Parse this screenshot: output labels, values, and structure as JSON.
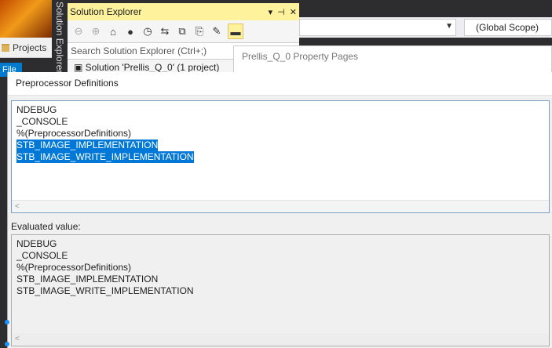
{
  "main_window": {
    "tab_projects": "Projects",
    "menu_file": "File",
    "vertical_tab": "Solution Explorer"
  },
  "solution_explorer": {
    "title": "Solution Explorer",
    "title_controls": [
      "▾",
      "⊣",
      "✕"
    ],
    "toolbar_icons": [
      "back-icon",
      "forward-icon",
      "home-icon",
      "globe-icon",
      "history-icon",
      "sync-icon",
      "collapse-all-icon",
      "show-all-files-icon",
      "properties-icon",
      "preview-icon"
    ],
    "search_placeholder": "Search Solution Explorer (Ctrl+;)",
    "tree_root": "Solution 'Prellis_Q_0' (1 project)"
  },
  "editor_nav": {
    "scope_combo_value": "",
    "global_scope": "(Global Scope)"
  },
  "property_pages": {
    "title": "Prellis_Q_0 Property Pages"
  },
  "dialog": {
    "title": "Preprocessor Definitions",
    "edit_lines": [
      {
        "text": "NDEBUG",
        "selected": false
      },
      {
        "text": "_CONSOLE",
        "selected": false
      },
      {
        "text": "%(PreprocessorDefinitions)",
        "selected": false
      },
      {
        "text": "STB_IMAGE_IMPLEMENTATION",
        "selected": true
      },
      {
        "text": "STB_IMAGE_WRITE_IMPLEMENTATION",
        "selected": true
      }
    ],
    "evaluated_label": "Evaluated value:",
    "evaluated_lines": [
      "NDEBUG",
      "_CONSOLE",
      "%(PreprocessorDefinitions)",
      "STB_IMAGE_IMPLEMENTATION",
      "STB_IMAGE_WRITE_IMPLEMENTATION"
    ],
    "scroll_left_glyph": "<"
  },
  "colors": {
    "selection": "#0078d7",
    "tool_window_active": "#fff29d",
    "accent": "#007acc"
  }
}
